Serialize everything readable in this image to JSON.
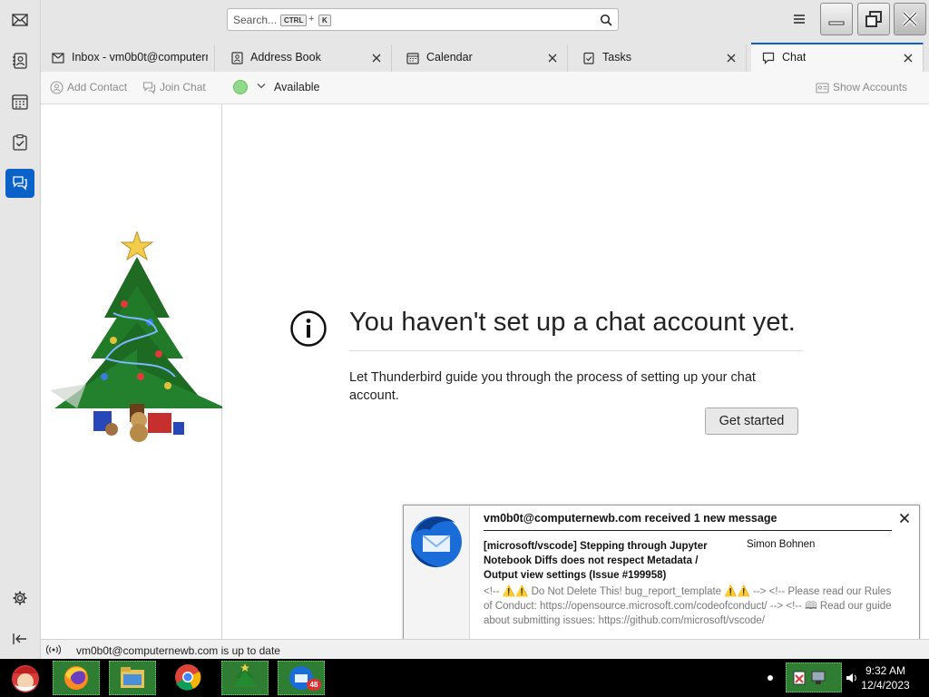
{
  "search": {
    "placeholder": "Search...",
    "shortcut_ctrl": "CTRL",
    "shortcut_plus": "+",
    "shortcut_key": "K"
  },
  "tabs": [
    {
      "label": "Inbox - vm0b0t@computernewb.com",
      "icon": "inbox-icon"
    },
    {
      "label": "Address Book",
      "icon": "address-book-icon"
    },
    {
      "label": "Calendar",
      "icon": "calendar-icon"
    },
    {
      "label": "Tasks",
      "icon": "tasks-icon"
    },
    {
      "label": "Chat",
      "icon": "chat-icon"
    }
  ],
  "toolbar": {
    "add_contact": "Add Contact",
    "join_chat": "Join Chat",
    "status": "Available",
    "show_accounts": "Show Accounts"
  },
  "main": {
    "headline": "You haven't set up a chat account yet.",
    "description": "Let Thunderbird guide you through the process of setting up your chat account.",
    "get_started": "Get started"
  },
  "notification": {
    "title": "vm0b0t@computernewb.com received 1 new message",
    "subject": "[microsoft/vscode] Stepping through Jupyter Notebook Diffs does not respect Metadata / Output view settings (Issue #199958)",
    "sender": "Simon Bohnen",
    "preview": "<!-- ⚠️⚠️ Do Not Delete This! bug_report_template ⚠️⚠️ --> <!-- Please read our Rules of Conduct: https://opensource.microsoft.com/codeofconduct/ --> <!-- 🕮 Read our guide about submitting issues: https://github.com/microsoft/vscode/"
  },
  "statusbar": {
    "text": "vm0b0t@computernewb.com is up to date"
  },
  "taskbar": {
    "time": "9:32 AM",
    "date": "12/4/2023",
    "badge_count": "48"
  },
  "colors": {
    "accent": "#0a62c9",
    "status_available": "#8fd98a",
    "taskbar_running": "#2e7d32"
  }
}
